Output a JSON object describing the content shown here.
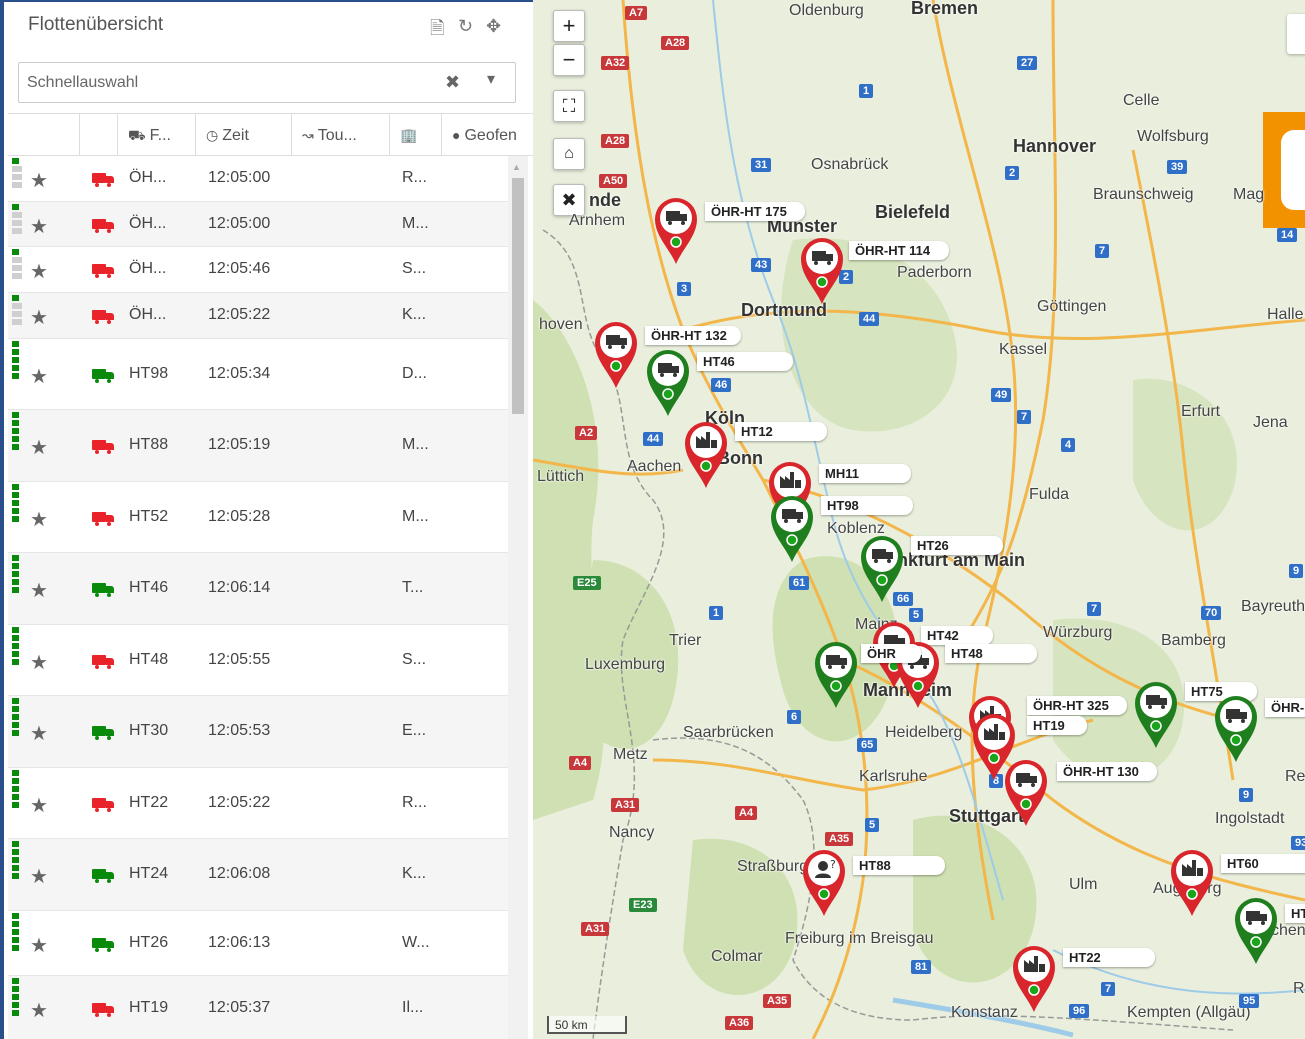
{
  "panel": {
    "title": "Flottenübersicht",
    "search_placeholder": "Schnellauswahl",
    "header_icons": [
      "pdf-icon",
      "refresh-icon",
      "move-icon"
    ]
  },
  "columns": [
    {
      "key": "status",
      "label": ""
    },
    {
      "key": "fav",
      "label": ""
    },
    {
      "key": "vehicle",
      "label": "F...",
      "icon": "truck-icon"
    },
    {
      "key": "time",
      "label": "Zeit",
      "icon": "clock-icon"
    },
    {
      "key": "tour",
      "label": "Tou...",
      "icon": "route-icon"
    },
    {
      "key": "place",
      "label": "",
      "icon": "building-icon"
    },
    {
      "key": "geofence",
      "label": "Geofen",
      "icon": "map-marker-icon"
    }
  ],
  "rows": [
    {
      "name": "ÖH...",
      "time": "12:05:00",
      "place": "R...",
      "truck_color": "red",
      "status_marks": [
        true,
        false,
        false,
        false
      ]
    },
    {
      "name": "ÖH...",
      "time": "12:05:00",
      "place": "M...",
      "truck_color": "red",
      "status_marks": [
        true,
        false,
        false,
        false
      ]
    },
    {
      "name": "ÖH...",
      "time": "12:05:46",
      "place": "S...",
      "truck_color": "red",
      "status_marks": [
        true,
        false,
        false,
        false
      ]
    },
    {
      "name": "ÖH...",
      "time": "12:05:22",
      "place": "K...",
      "truck_color": "red",
      "status_marks": [
        true,
        false,
        false,
        false
      ]
    },
    {
      "name": "HT98",
      "time": "12:05:34",
      "place": "D...",
      "truck_color": "green",
      "status_marks": [
        true,
        true,
        true,
        true,
        true
      ]
    },
    {
      "name": "HT88",
      "time": "12:05:19",
      "place": "M...",
      "truck_color": "red",
      "status_marks": [
        true,
        true,
        true,
        true,
        true
      ]
    },
    {
      "name": "HT52",
      "time": "12:05:28",
      "place": "M...",
      "truck_color": "red",
      "status_marks": [
        true,
        true,
        true,
        true,
        true
      ]
    },
    {
      "name": "HT46",
      "time": "12:06:14",
      "place": "T...",
      "truck_color": "green",
      "status_marks": [
        true,
        true,
        true,
        true,
        true
      ]
    },
    {
      "name": "HT48",
      "time": "12:05:55",
      "place": "S...",
      "truck_color": "red",
      "status_marks": [
        true,
        true,
        true,
        true,
        true
      ]
    },
    {
      "name": "HT30",
      "time": "12:05:53",
      "place": "E...",
      "truck_color": "green",
      "status_marks": [
        true,
        true,
        true,
        true,
        true
      ]
    },
    {
      "name": "HT22",
      "time": "12:05:22",
      "place": "R...",
      "truck_color": "red",
      "status_marks": [
        true,
        true,
        true,
        true,
        true
      ]
    },
    {
      "name": "HT24",
      "time": "12:06:08",
      "place": "K...",
      "truck_color": "green",
      "status_marks": [
        true,
        true,
        true,
        true,
        true
      ]
    },
    {
      "name": "HT26",
      "time": "12:06:13",
      "place": "W...",
      "truck_color": "green",
      "status_marks": [
        true,
        true,
        true,
        true,
        true
      ]
    },
    {
      "name": "HT19",
      "time": "12:05:37",
      "place": "Il...",
      "truck_color": "red",
      "status_marks": [
        true,
        true,
        true,
        true,
        true
      ]
    }
  ],
  "map": {
    "zoom_in": "+",
    "zoom_out": "−",
    "scale_label": "50 km",
    "cities": [
      "Oldenburg",
      "Bremen",
      "Celle",
      "Hannover",
      "Wolfsburg",
      "Braunschweig",
      "Mag",
      "Osnabrück",
      "Bielefeld",
      "Münster",
      "Paderborn",
      "Arnhem",
      "Dortmund",
      "Göttingen",
      "Halle",
      "Kassel",
      "hoven",
      "Köln",
      "Bonn",
      "Aachen",
      "Lüttich",
      "Erfurt",
      "Jena",
      "Fulda",
      "Frankfurt am Main",
      "Mainz",
      "Würzburg",
      "Bamberg",
      "Bayreuth",
      "Trier",
      "Luxemburg",
      "Mannheim",
      "Heidelberg",
      "Saarbrücken",
      "Metz",
      "Karlsruhe",
      "Stuttgart",
      "Ingolstadt",
      "Nancy",
      "Straßburg",
      "Ulm",
      "Augsburg",
      "Freiburg im Breisgau",
      "Colmar",
      "Konstanz",
      "Kempten (Allgäu)",
      "Re",
      "Koblenz",
      "nde",
      "R",
      "chen"
    ],
    "road_labels": [
      "A7",
      "A28",
      "A32",
      "A28",
      "A50",
      "27",
      "1",
      "31",
      "39",
      "2",
      "43",
      "3",
      "2",
      "44",
      "7",
      "14",
      "A2",
      "44",
      "46",
      "49",
      "7",
      "4",
      "E25",
      "61",
      "66",
      "5",
      "1",
      "7",
      "70",
      "9",
      "6",
      "65",
      "8",
      "9",
      "A4",
      "A31",
      "A4",
      "A35",
      "5",
      "E23",
      "A31",
      "81",
      "7",
      "A35",
      "A36",
      "96",
      "95",
      "93"
    ],
    "markers": [
      {
        "label": "ÖHR-HT 175",
        "color": "red",
        "icon": "truck"
      },
      {
        "label": "ÖHR-HT 114",
        "color": "red",
        "icon": "truck"
      },
      {
        "label": "ÖHR-HT 132",
        "color": "red",
        "icon": "truck"
      },
      {
        "label": "HT46",
        "color": "green",
        "icon": "truck"
      },
      {
        "label": "HT12",
        "color": "red",
        "icon": "factory"
      },
      {
        "label": "MH11",
        "color": "red",
        "icon": "factory"
      },
      {
        "label": "HT98",
        "color": "green",
        "icon": "truck"
      },
      {
        "label": "HT26",
        "color": "green",
        "icon": "truck"
      },
      {
        "label": "HT42",
        "color": "red",
        "icon": "truck"
      },
      {
        "label": "HT48",
        "color": "red",
        "icon": "truck"
      },
      {
        "label": "ÖHR",
        "color": "green",
        "icon": "truck"
      },
      {
        "label": "ÖHR-HT 325",
        "color": "red",
        "icon": "factory"
      },
      {
        "label": "HT19",
        "color": "red",
        "icon": "factory"
      },
      {
        "label": "HT75",
        "color": "green",
        "icon": "truck"
      },
      {
        "label": "ÖHR-",
        "color": "green",
        "icon": "truck"
      },
      {
        "label": "ÖHR-HT 130",
        "color": "red",
        "icon": "truck"
      },
      {
        "label": "HT88",
        "color": "red",
        "icon": "question"
      },
      {
        "label": "HT60",
        "color": "red",
        "icon": "factory"
      },
      {
        "label": "HT",
        "color": "green",
        "icon": "truck"
      },
      {
        "label": "HT22",
        "color": "red",
        "icon": "factory"
      }
    ]
  },
  "colors": {
    "green": "#0a8a0a",
    "red": "#e8232a",
    "panel_border": "#2a4f8a",
    "orange": "#f39200"
  }
}
